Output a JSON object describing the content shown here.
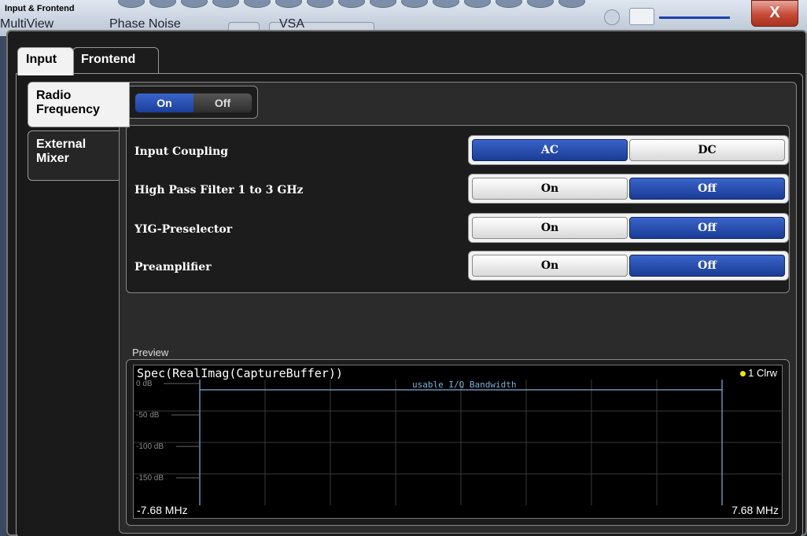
{
  "window": {
    "title": "Input & Frontend",
    "close_label": "X"
  },
  "background": {
    "multiview_label": "MultiView",
    "phase_noise_label": "Phase Noise",
    "vsa_label": "VSA"
  },
  "tabs": [
    {
      "label": "Input",
      "active": true
    },
    {
      "label": "Frontend",
      "active": false
    }
  ],
  "side_tabs": [
    {
      "label_line1": "Radio",
      "label_line2": "Frequency",
      "active": true
    },
    {
      "label_line1": "External",
      "label_line2": "Mixer",
      "active": false
    }
  ],
  "radio_frequency_toggle": {
    "on_label": "On",
    "off_label": "Off",
    "selected": "On"
  },
  "settings": [
    {
      "label": "Input Coupling",
      "options": [
        "AC",
        "DC"
      ],
      "selected": "AC"
    },
    {
      "label": "High Pass Filter 1 to 3 GHz",
      "options": [
        "On",
        "Off"
      ],
      "selected": "Off"
    },
    {
      "label": "YIG-Preselector",
      "options": [
        "On",
        "Off"
      ],
      "selected": "Off"
    },
    {
      "label": "Preamplifier",
      "options": [
        "On",
        "Off"
      ],
      "selected": "Off"
    }
  ],
  "preview": {
    "label": "Preview",
    "plot_title": "Spec(RealImag(CaptureBuffer))",
    "legend": "1 Clrw",
    "legend_color": "#f2e600",
    "annotation": "usable I/Q Bandwidth",
    "x_min_label": "-7.68 MHz",
    "x_max_label": "7.68 MHz",
    "y_ticks": [
      "0 dB",
      "-50 dB",
      "-100 dB",
      "-150 dB"
    ]
  },
  "colors": {
    "accent_blue": "#2a50b8",
    "plot_line": "#7fb0d8"
  }
}
